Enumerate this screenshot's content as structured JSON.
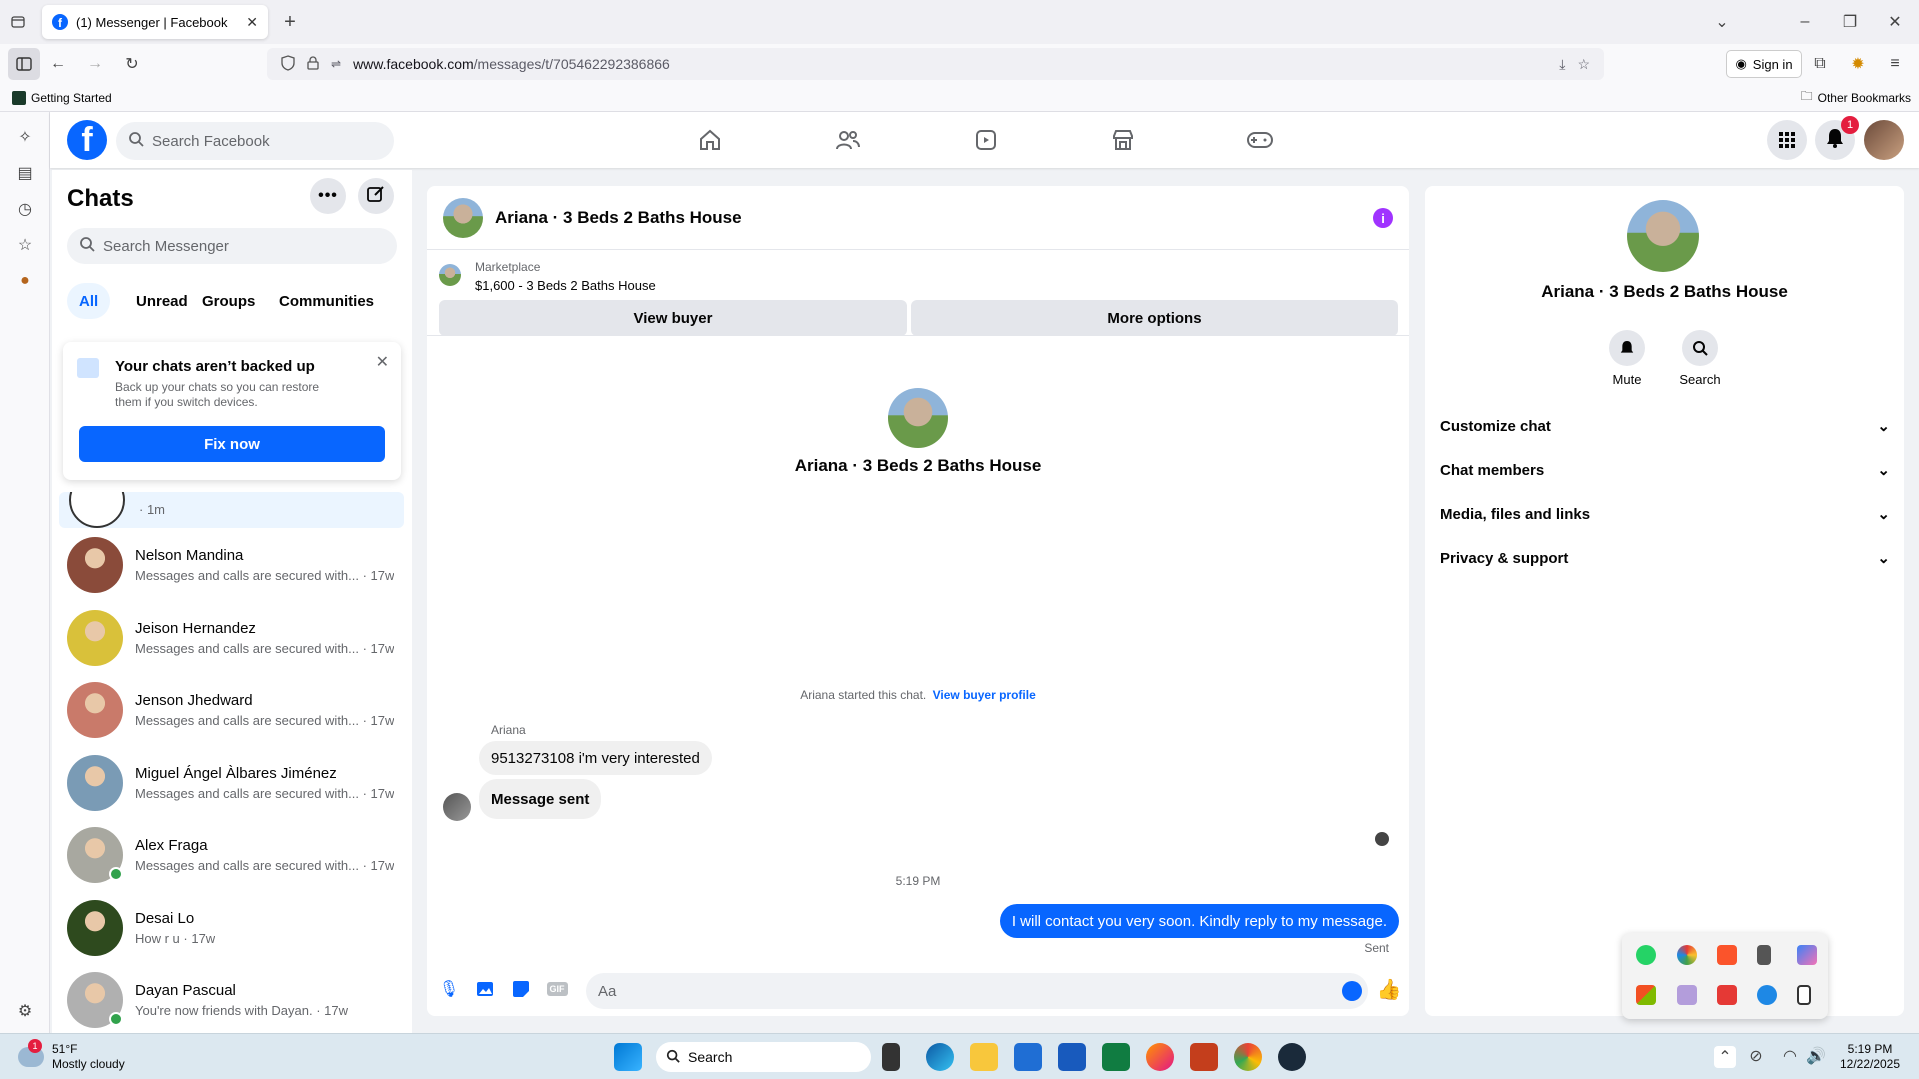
{
  "browser": {
    "tab_title": "(1) Messenger | Facebook",
    "url_domain": "www.facebook.com",
    "url_path": "/messages/t/705462292386866",
    "sign_in": "Sign in",
    "bookmark_getting_started": "Getting Started",
    "bookmark_other": "Other Bookmarks"
  },
  "fb": {
    "search_placeholder": "Search Facebook",
    "notification_count": "1"
  },
  "chats": {
    "title": "Chats",
    "search_placeholder": "Search Messenger",
    "filters": [
      "All",
      "Unread",
      "Groups",
      "Communities"
    ],
    "backup": {
      "title": "Your chats aren’t backed up",
      "body": "Back up your chats so you can restore them if you switch devices.",
      "button": "Fix now"
    },
    "active_item_time": "· 1m",
    "items": [
      {
        "name": "Nelson Mandina",
        "preview": "Messages and calls are secured with... · 17w",
        "color": "#8a4b3a",
        "online": false
      },
      {
        "name": "Jeison Hernandez",
        "preview": "Messages and calls are secured with... · 17w",
        "color": "#d9c13a",
        "online": false
      },
      {
        "name": "Jenson Jhedward",
        "preview": "Messages and calls are secured with... · 17w",
        "color": "#c97a6a",
        "online": false
      },
      {
        "name": "Miguel Ángel Àlbares Jiménez",
        "preview": "Messages and calls are secured with... · 17w",
        "color": "#7a9bb5",
        "online": false
      },
      {
        "name": "Alex Fraga",
        "preview": "Messages and calls are secured with... · 17w",
        "color": "#a8a8a0",
        "online": true
      },
      {
        "name": "Desai Lo",
        "preview": "How r u · 17w",
        "color": "#2e4a1e",
        "online": false
      },
      {
        "name": "Dayan Pascual",
        "preview": "You're now friends with Dayan. · 17w",
        "color": "#b0b0b0",
        "online": true
      }
    ]
  },
  "conversation": {
    "title": "Ariana · 3 Beds 2 Baths House",
    "marketplace_label": "Marketplace",
    "listing": "$1,600 - 3 Beds 2 Baths House",
    "view_buyer": "View buyer",
    "more_options": "More options",
    "center_name": "Ariana · 3 Beds 2 Baths House",
    "started_text": "Ariana started this chat.",
    "view_buyer_profile": "View buyer profile",
    "sender_name": "Ariana",
    "msg1": "9513273108 i'm very interested",
    "msg2": "Message sent",
    "timestamp": "5:19 PM",
    "my_msg": "I will contact you very soon. Kindly reply to my message.",
    "sent_status": "Sent",
    "composer_placeholder": "Aa"
  },
  "info": {
    "name": "Ariana · 3 Beds 2 Baths House",
    "mute": "Mute",
    "search": "Search",
    "sections": [
      "Customize chat",
      "Chat members",
      "Media, files and links",
      "Privacy & support"
    ]
  },
  "taskbar": {
    "weather_temp": "51°F",
    "weather_desc": "Mostly cloudy",
    "weather_badge": "1",
    "search": "Search",
    "time": "5:19 PM",
    "date": "12/22/2025"
  },
  "colors": {
    "fb_blue": "#0866ff",
    "online_green": "#31a24c",
    "info_purple": "#a033ff"
  }
}
